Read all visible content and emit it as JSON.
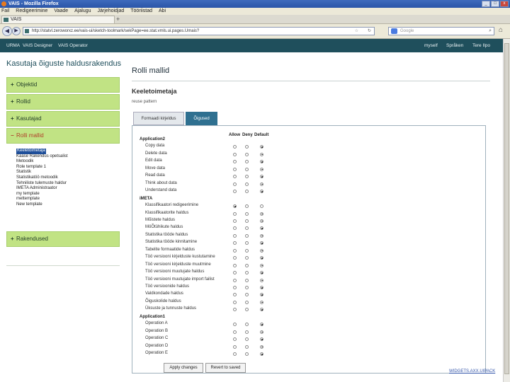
{
  "browser": {
    "window_title": "VAIS - Mozilla Firefox",
    "menu": [
      "Fail",
      "Redigeerimine",
      "Vaade",
      "Ajalugu",
      "Järjehoidjad",
      "Tööriistad",
      "Abi"
    ],
    "tab_title": "VAIS",
    "tab_new": "+",
    "url": "http://statvl.zeroworxz.ee/vais-ui/sketch-toolmark/sekPage=ee.stat.vmls.ui.pages.Umais?",
    "search_placeholder": "Google",
    "window_buttons": [
      "_",
      "□",
      "x"
    ]
  },
  "appnav": {
    "left": [
      "URMA",
      "VAIS Designer",
      "VAIS Operator"
    ],
    "right": [
      "myself",
      "Språken",
      "Tere Ilpo"
    ]
  },
  "app_title": "Kasutaja õiguste haldusrakendus",
  "sidebar": {
    "items": [
      {
        "sign": "+",
        "label": "Objektid"
      },
      {
        "sign": "+",
        "label": "Rollid"
      },
      {
        "sign": "+",
        "label": "Kasutajad"
      },
      {
        "sign": "−",
        "label": "Rolli mallid"
      }
    ],
    "subitems": [
      "Keeletoimetaja",
      "Kaase Rakendus opetsalist",
      "Metoodik",
      "Role template 1",
      "Statistik",
      "Statistikatöö metoodik",
      "Tehniliste tulemuste haldur",
      "IMETA Administraator",
      "my template",
      "mettemplate",
      "New template"
    ],
    "bottom": {
      "sign": "+",
      "label": "Rakendused"
    }
  },
  "page": {
    "title": "Rolli mallid",
    "section_title": "Keeletoimetaja",
    "section_sub": "reuse pattern",
    "tabs": [
      "Formaadi kirjeldus",
      "Õigused"
    ]
  },
  "permissions": {
    "columns": [
      "Allow",
      "Deny",
      "Default"
    ],
    "groups": [
      {
        "name": "Application2",
        "rows": [
          {
            "label": "Copy data",
            "value": 2
          },
          {
            "label": "Delete data",
            "value": 2
          },
          {
            "label": "Edit data",
            "value": 2
          },
          {
            "label": "Move data",
            "value": 2
          },
          {
            "label": "Read data",
            "value": 2
          },
          {
            "label": "Think about data",
            "value": 2
          },
          {
            "label": "Understand data",
            "value": 2
          }
        ]
      },
      {
        "name": "iMETA",
        "rows": [
          {
            "label": "Klassifikaatori redigeerimine",
            "value": 0
          },
          {
            "label": "Klassifikaatorite haldus",
            "value": 2
          },
          {
            "label": "Mõistete haldus",
            "value": 2
          },
          {
            "label": "MöÕtühikute haldus",
            "value": 2
          },
          {
            "label": "Statistika tööde haldus",
            "value": 2
          },
          {
            "label": "Statistika tööde kinnitamine",
            "value": 2
          },
          {
            "label": "Tabelite formaatide haldus",
            "value": 2
          },
          {
            "label": "Töö versiooni kirjelduste kustutamine",
            "value": 2
          },
          {
            "label": "Töö versiooni kirjelduste muutmine",
            "value": 2
          },
          {
            "label": "Töö versiooni muutujate haldus",
            "value": 2
          },
          {
            "label": "Töö versiooni muutujate import failist",
            "value": 2
          },
          {
            "label": "Töö versioonide haldus",
            "value": 2
          },
          {
            "label": "Valdkondade haldus",
            "value": 2
          },
          {
            "label": "Õiguskolide haldus",
            "value": 2
          },
          {
            "label": "Üksuste ja tunnuste haldus",
            "value": 2
          }
        ]
      },
      {
        "name": "Application1",
        "rows": [
          {
            "label": "Operation A",
            "value": 2
          },
          {
            "label": "Operation B",
            "value": 2
          },
          {
            "label": "Operation C",
            "value": 2
          },
          {
            "label": "Operation D",
            "value": 2
          },
          {
            "label": "Operation E",
            "value": 2
          }
        ]
      }
    ],
    "apply_label": "Apply changes",
    "revert_label": "Revert to saved"
  },
  "footer_link": "WIDGETS.AXX.UIPACK"
}
